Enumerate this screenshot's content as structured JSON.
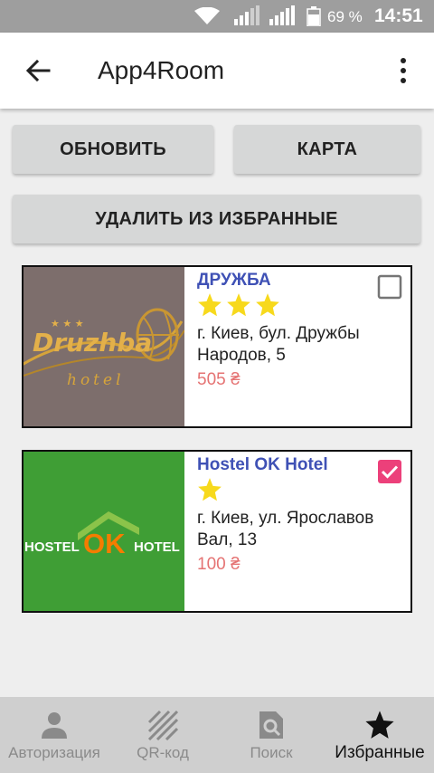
{
  "status_bar": {
    "battery": "69 %",
    "time": "14:51"
  },
  "app_bar": {
    "title": "App4Room"
  },
  "actions": {
    "refresh_label": "ОБНОВИТЬ",
    "map_label": "КАРТА",
    "delete_label": "УДАЛИТЬ ИЗ ИЗБРАННЫЕ"
  },
  "hotels": [
    {
      "name": "ДРУЖБА",
      "stars": 3,
      "address": "г. Киев, бул. Дружбы Народов, 5",
      "price": "505 ₴",
      "checked": false,
      "logo_text": "Druzhba",
      "logo_subtext": "hotel"
    },
    {
      "name": "Hostel OK Hotel",
      "stars": 1,
      "address": "г. Киев, ул. Ярославов Вал, 13",
      "price": "100 ₴",
      "checked": true,
      "logo_left": "HOSTEL",
      "logo_mid": "OK",
      "logo_right": "HOTEL"
    }
  ],
  "bottom_nav": [
    {
      "label": "Авторизация",
      "icon": "person-icon"
    },
    {
      "label": "QR-код",
      "icon": "qr-icon"
    },
    {
      "label": "Поиск",
      "icon": "search-icon"
    },
    {
      "label": "Избранные",
      "icon": "star-icon"
    }
  ],
  "colors": {
    "accent": "#3f51b5",
    "price": "#e57373",
    "checkbox": "#ec407a",
    "star": "#f7d91c"
  }
}
